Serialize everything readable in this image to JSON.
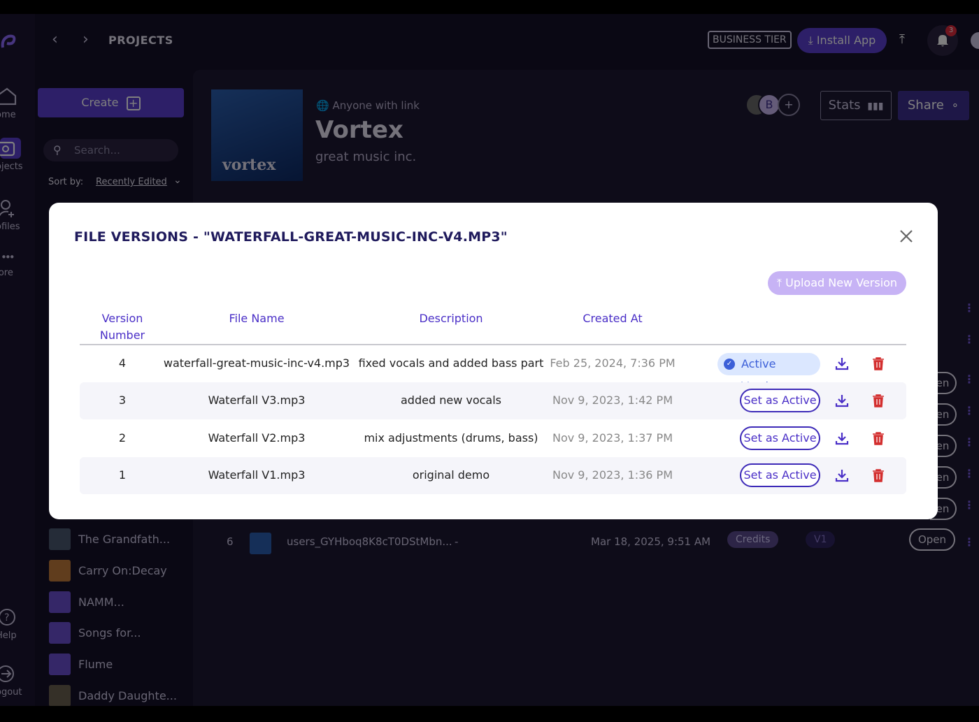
{
  "topbar": {
    "crumb": "PROJECTS",
    "tier": "BUSINESS TIER",
    "install": "Install App",
    "notif_count": "3"
  },
  "rail": {
    "items": [
      {
        "label": "ome",
        "icon": "home-icon"
      },
      {
        "label": "ojects",
        "icon": "projects-icon"
      },
      {
        "label": "ofiles",
        "icon": "profiles-icon"
      },
      {
        "label": "Iore",
        "icon": "more-icon"
      },
      {
        "label": "Help",
        "icon": "help-icon"
      },
      {
        "label": "ogout",
        "icon": "logout-icon"
      }
    ]
  },
  "sidebar": {
    "create": "Create",
    "search_placeholder": "Search...",
    "sort_label": "Sort by:",
    "sort_value": "Recently Edited",
    "projects": [
      {
        "name": "The Grandfath..."
      },
      {
        "name": "Carry On:Decay"
      },
      {
        "name": "NAMM..."
      },
      {
        "name": "Songs for..."
      },
      {
        "name": "Flume"
      },
      {
        "name": "Daddy Daughte..."
      }
    ]
  },
  "project": {
    "cover_text": "vortex",
    "visibility": "Anyone with link",
    "title": "Vortex",
    "subtitle": "great music inc.",
    "avatar_letter": "B",
    "avatar_add": "+",
    "stats": "Stats",
    "share": "Share"
  },
  "bg_row": {
    "num": "6",
    "file": "users_GYHboq8K8cT0DStMbn...",
    "dash": "-",
    "date": "Mar 18, 2025, 9:51 AM",
    "credits": "Credits",
    "version": "V1",
    "open": "Open",
    "open_partial": "en"
  },
  "modal": {
    "title": "FILE VERSIONS - \"WATERFALL-GREAT-MUSIC-INC-V4.MP3\"",
    "upload": "Upload New Version",
    "headers": {
      "version_1": "Version",
      "version_2": "Number",
      "file": "File Name",
      "description": "Description",
      "created": "Created At"
    },
    "active_label": "Active Version",
    "set_active_label": "Set as Active",
    "rows": [
      {
        "num": "4",
        "file": "waterfall-great-music-inc-v4.mp3",
        "desc": "fixed vocals and added bass part",
        "date": "Feb 25, 2024, 7:36 PM"
      },
      {
        "num": "3",
        "file": "Waterfall V3.mp3",
        "desc": "added new vocals",
        "date": "Nov 9, 2023, 1:42 PM"
      },
      {
        "num": "2",
        "file": "Waterfall V2.mp3",
        "desc": "mix adjustments (drums, bass)",
        "date": "Nov 9, 2023, 1:37 PM"
      },
      {
        "num": "1",
        "file": "Waterfall V1.mp3",
        "desc": "original demo",
        "date": "Nov 9, 2023, 1:36 PM"
      }
    ]
  }
}
